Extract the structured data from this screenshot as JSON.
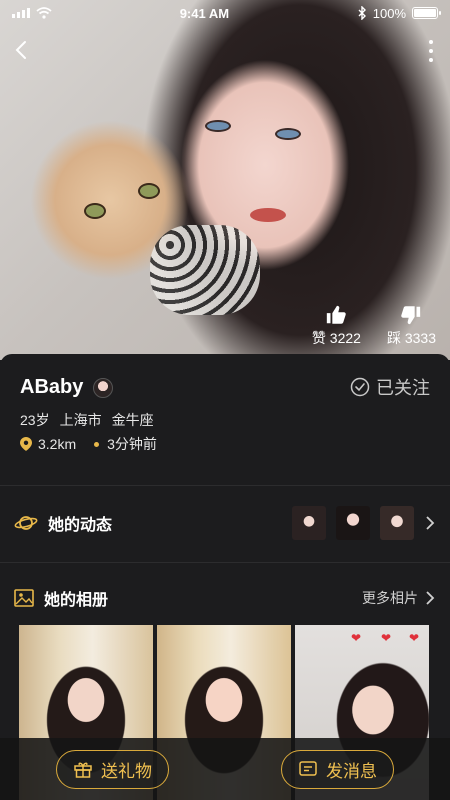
{
  "status_bar": {
    "time": "9:41 AM",
    "battery": "100%"
  },
  "votes": {
    "like_label": "赞 3222",
    "dislike_label": "踩 3333"
  },
  "profile": {
    "name": "ABaby",
    "follow_label": "已关注",
    "age": "23岁",
    "city": "上海市",
    "zodiac": "金牛座",
    "distance": "3.2km",
    "last_active": "3分钟前"
  },
  "moments": {
    "title": "她的动态"
  },
  "album": {
    "title": "她的相册",
    "more_label": "更多相片"
  },
  "actions": {
    "gift_label": "送礼物",
    "message_label": "发消息"
  },
  "colors": {
    "accent": "#e8b84a",
    "panel_bg": "#1c1c1e"
  }
}
